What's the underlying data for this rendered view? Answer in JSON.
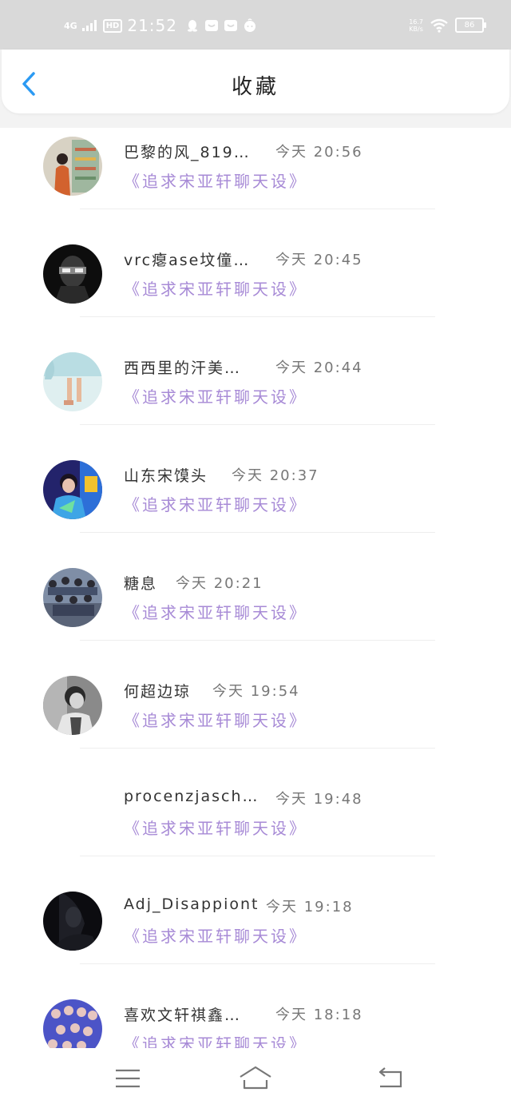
{
  "status_bar": {
    "network": "4G",
    "hd": "HD",
    "time": "21:52",
    "speed_value": "16.7",
    "speed_unit": "KB/s",
    "battery": "86"
  },
  "header": {
    "title": "收藏"
  },
  "favorites": [
    {
      "name": "巴黎的风_819…",
      "time": "今天 20:56",
      "link": "《追求宋亚轩聊天设》",
      "avatar": "photo"
    },
    {
      "name": "vrc瘪ase坟僮…",
      "time": "今天 20:45",
      "link": "《追求宋亚轩聊天设》",
      "avatar": "photo"
    },
    {
      "name": "西西里的汗美…",
      "time": "今天 20:44",
      "link": "《追求宋亚轩聊天设》",
      "avatar": "photo"
    },
    {
      "name": "山东宋馍头",
      "time": "今天 20:37",
      "link": "《追求宋亚轩聊天设》",
      "avatar": "photo"
    },
    {
      "name": "糖息",
      "time": "今天 20:21",
      "link": "《追求宋亚轩聊天设》",
      "avatar": "photo"
    },
    {
      "name": "何超边琼",
      "time": "今天 19:54",
      "link": "《追求宋亚轩聊天设》",
      "avatar": "photo"
    },
    {
      "name": "procenzjasch…",
      "time": "今天 19:48",
      "link": "《追求宋亚轩聊天设》",
      "avatar": "none"
    },
    {
      "name": "Adj_Disappiont",
      "time": "今天 19:18",
      "link": "《追求宋亚轩聊天设》",
      "avatar": "photo"
    },
    {
      "name": "喜欢文轩祺鑫…",
      "time": "今天 18:18",
      "link": "《追求宋亚轩聊天设》",
      "avatar": "photo"
    }
  ],
  "colors": {
    "accent": "#2b9af3",
    "link": "#a78ad6",
    "status_bar": "#d9d9d9"
  },
  "nav": {
    "menu": "menu-icon",
    "home": "home-icon",
    "back": "back-icon"
  }
}
